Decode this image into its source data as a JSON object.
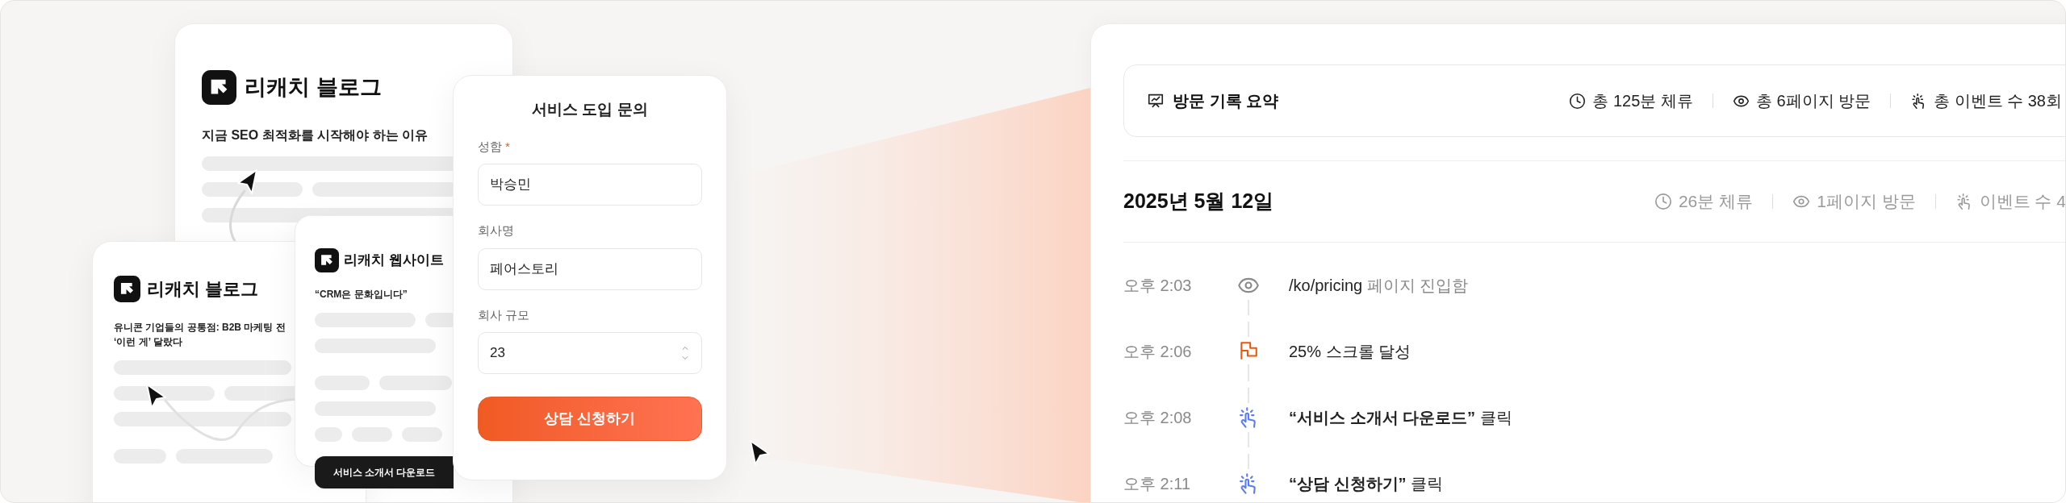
{
  "blog_card_main": {
    "brand": "리캐치 블로그",
    "headline": "지금 SEO 최적화를 시작해야 하는 이유"
  },
  "blog_card_secondary": {
    "brand": "리캐치 블로그",
    "headline_lines": [
      "유니콘 기업들의 공통점: B2B 마케팅 전",
      "‘이런 게’ 달랐다"
    ]
  },
  "website_card": {
    "brand": "리캐치 웹사이트",
    "quote": "“CRM은 문화입니다”",
    "button": "서비스 소개서 다운로드"
  },
  "form": {
    "title": "서비스 도입 문의",
    "fields": [
      {
        "label": "성함",
        "required_mark": "*",
        "value": "박승민",
        "kind": "text"
      },
      {
        "label": "회사명",
        "value": "페어스토리",
        "kind": "text"
      },
      {
        "label": "회사 규모",
        "value": "23",
        "kind": "number"
      }
    ],
    "submit": "상담 신청하기"
  },
  "summary": {
    "title": "방문 기록 요약",
    "stats": [
      {
        "kind": "time",
        "text": "총 125분 체류"
      },
      {
        "kind": "pages",
        "text": "총 6페이지 방문"
      },
      {
        "kind": "events",
        "text": "총 이벤트 수 38회"
      }
    ]
  },
  "session": {
    "date": "2025년 5월 12일",
    "stats": [
      {
        "kind": "time",
        "text": "26분 체류"
      },
      {
        "kind": "pages",
        "text": "1페이지 방문"
      },
      {
        "kind": "events",
        "text": "이벤트 수 4"
      }
    ]
  },
  "timeline": [
    {
      "time": "오후 2:03",
      "kind": "page_view",
      "subject": "/ko/pricing",
      "detail": "페이지 진입함"
    },
    {
      "time": "오후 2:06",
      "kind": "scroll",
      "subject": "25% 스크롤 달성"
    },
    {
      "time": "오후 2:08",
      "kind": "click",
      "subject": "“서비스 소개서 다운로드”",
      "detail": "클릭"
    },
    {
      "time": "오후 2:11",
      "kind": "click",
      "subject": "“상담 신청하기”",
      "detail": "클릭"
    }
  ]
}
